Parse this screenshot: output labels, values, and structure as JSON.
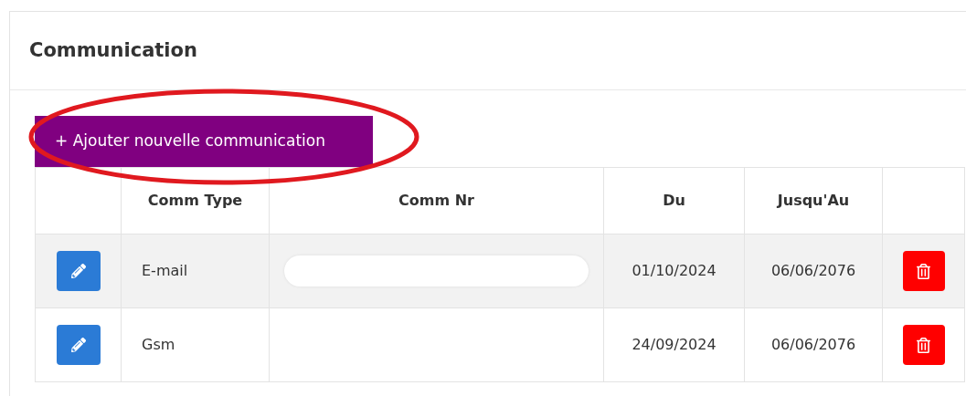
{
  "card": {
    "title": "Communication"
  },
  "add_button": {
    "label": "+ Ajouter nouvelle communication",
    "circled": true
  },
  "table": {
    "columns": [
      "",
      "Comm Type",
      "Comm Nr",
      "Du",
      "Jusqu'Au",
      ""
    ],
    "rows": [
      {
        "comm_type": "E-mail",
        "comm_nr_redacted": true,
        "du": "01/10/2024",
        "jusqu_au": "06/06/2076"
      },
      {
        "comm_type": "Gsm",
        "comm_nr_redacted": false,
        "du": "24/09/2024",
        "jusqu_au": "06/06/2076"
      }
    ]
  }
}
